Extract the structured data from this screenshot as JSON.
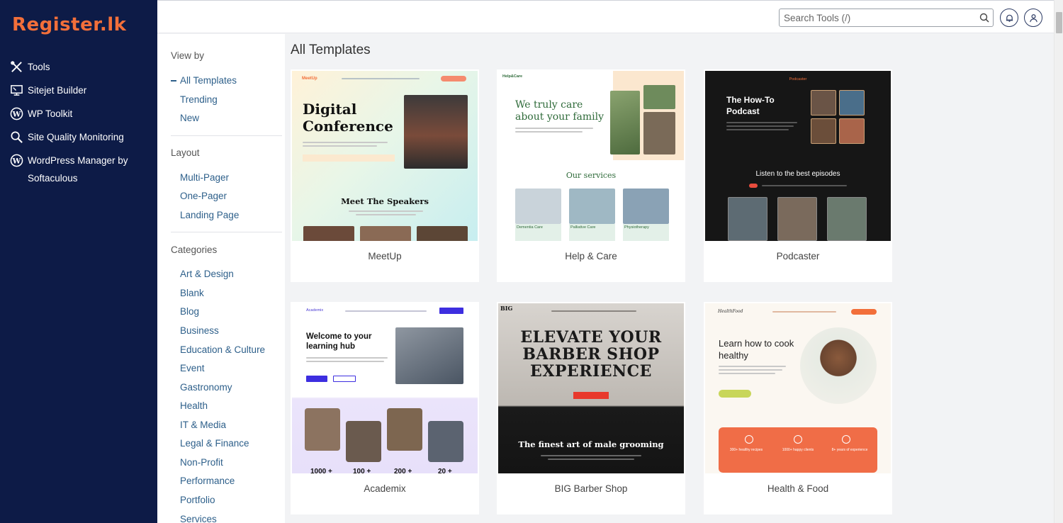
{
  "brand": {
    "logo_text": "Register.lk",
    "logo_color": "#f26f3a"
  },
  "sidebar": {
    "items": [
      {
        "label": "Tools",
        "icon": "tools-icon"
      },
      {
        "label": "Sitejet Builder",
        "icon": "sitejet-icon"
      },
      {
        "label": "WP Toolkit",
        "icon": "wordpress-icon"
      },
      {
        "label": "Site Quality Monitoring",
        "icon": "magnifier-icon"
      },
      {
        "label": "WordPress Manager by Softaculous",
        "icon": "wordpress-icon"
      }
    ]
  },
  "topbar": {
    "search_placeholder": "Search Tools (/)",
    "search_icon": "search-icon",
    "notification_icon": "bell-icon",
    "user_icon": "user-icon"
  },
  "filters": {
    "view_by_heading": "View by",
    "view_by": [
      {
        "label": "All Templates",
        "active": true
      },
      {
        "label": "Trending",
        "active": false
      },
      {
        "label": "New",
        "active": false
      }
    ],
    "layout_heading": "Layout",
    "layout": [
      "Multi-Pager",
      "One-Pager",
      "Landing Page"
    ],
    "categories_heading": "Categories",
    "categories": [
      "Art & Design",
      "Blank",
      "Blog",
      "Business",
      "Education & Culture",
      "Event",
      "Gastronomy",
      "Health",
      "IT & Media",
      "Legal & Finance",
      "Non-Profit",
      "Performance",
      "Portfolio",
      "Services"
    ]
  },
  "main": {
    "title": "All Templates",
    "templates": [
      {
        "name": "MeetUp",
        "hero": "Digital Conference",
        "sub": "Meet The Speakers",
        "nav_logo": "MeetUp"
      },
      {
        "name": "Help & Care",
        "hero": "We truly care about your family",
        "sub": "Our services",
        "nav_logo": "Help&Care",
        "services": [
          "Dementia Care",
          "Palliative Care",
          "Physiotherapy"
        ]
      },
      {
        "name": "Podcaster",
        "hero": "The How-To Podcast",
        "sub": "Listen to the best episodes",
        "nav_logo": "Podcaster"
      },
      {
        "name": "Academix",
        "hero": "Welcome to your learning hub",
        "nav_logo": "Academix",
        "stats": [
          "1000 +",
          "100 +",
          "200 +",
          "20 +"
        ]
      },
      {
        "name": "BIG Barber Shop",
        "hero": "ELEVATE YOUR BARBER SHOP EXPERIENCE",
        "sub": "The finest art of male grooming",
        "nav_logo": "BIG"
      },
      {
        "name": "Health & Food",
        "hero": "Learn how to cook healthy",
        "nav_logo": "HealthFood",
        "stats": [
          "300+ healthy recipes",
          "1000+ happy clients",
          "8+ years of experience"
        ]
      }
    ]
  },
  "colors": {
    "sidebar_bg": "#0d1b47",
    "link": "#2d5f8a",
    "accent": "#f26f3a"
  }
}
